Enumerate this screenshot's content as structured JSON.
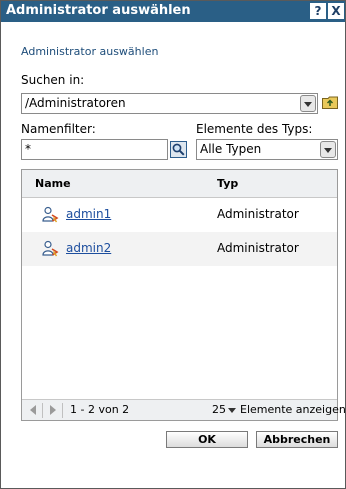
{
  "window": {
    "title": "Administrator auswählen",
    "help_label": "?",
    "close_label": "X"
  },
  "heading": "Administrator auswählen",
  "search_in": {
    "label": "Suchen in:",
    "value": "/Administratoren"
  },
  "name_filter": {
    "label": "Namenfilter:",
    "value": "*"
  },
  "type_filter": {
    "label": "Elemente des Typs:",
    "value": "Alle Typen"
  },
  "table": {
    "columns": [
      "Name",
      "Typ"
    ],
    "rows": [
      {
        "name": "admin1",
        "type": "Administrator"
      },
      {
        "name": "admin2",
        "type": "Administrator"
      }
    ]
  },
  "pager": {
    "range": "1 - 2 von 2",
    "per_page": "25",
    "per_page_label": "Elemente anzeigen"
  },
  "buttons": {
    "ok": "OK",
    "cancel": "Abbrechen"
  },
  "colors": {
    "titlebar": "#2a5f86",
    "link": "#1d4e9e",
    "heading": "#1e4d7a"
  }
}
